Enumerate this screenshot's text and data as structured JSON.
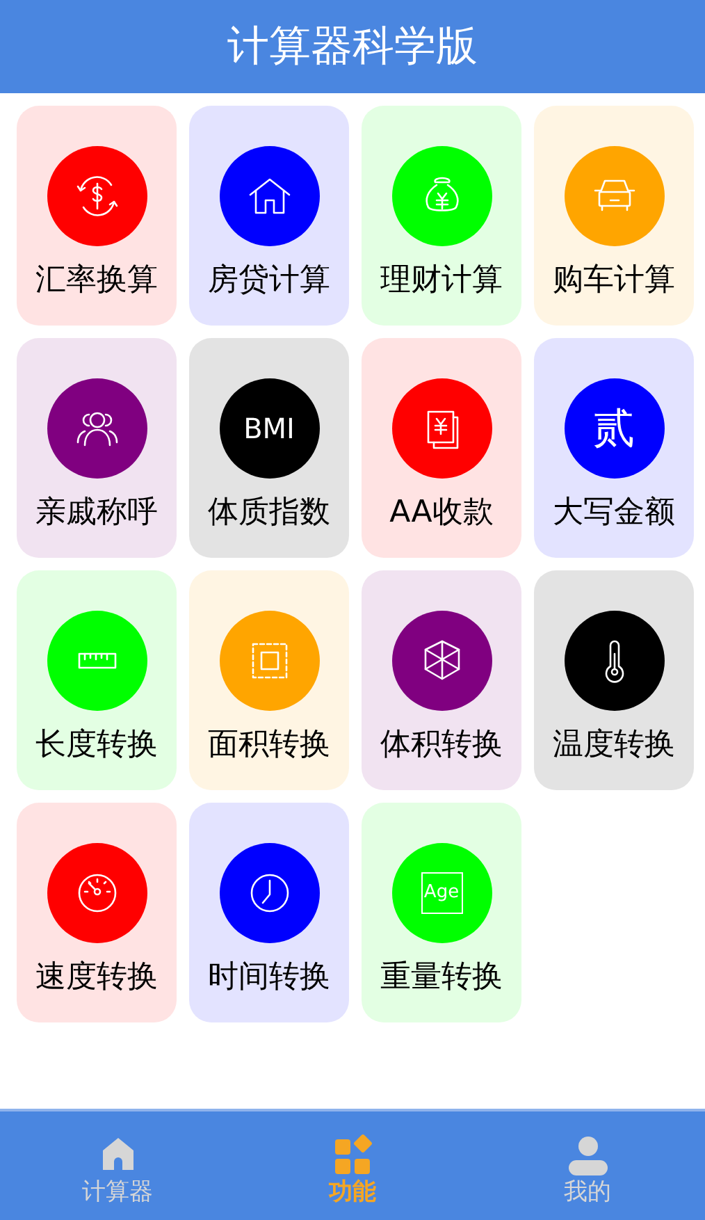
{
  "header": {
    "title": "计算器科学版"
  },
  "tools": [
    {
      "label": "汇率换算",
      "color": "#ff0000"
    },
    {
      "label": "房贷计算",
      "color": "#0000ff"
    },
    {
      "label": "理财计算",
      "color": "#00ff00"
    },
    {
      "label": "购车计算",
      "color": "#ffa500"
    },
    {
      "label": "亲戚称呼",
      "color": "#800080"
    },
    {
      "label": "体质指数",
      "color": "#000000",
      "icon_text": "BMI"
    },
    {
      "label": "AA收款",
      "color": "#ff0000"
    },
    {
      "label": "大写金额",
      "color": "#0000ff",
      "icon_text": "贰"
    },
    {
      "label": "长度转换",
      "color": "#00ff00"
    },
    {
      "label": "面积转换",
      "color": "#ffa500"
    },
    {
      "label": "体积转换",
      "color": "#800080"
    },
    {
      "label": "温度转换",
      "color": "#000000"
    },
    {
      "label": "速度转换",
      "color": "#ff0000"
    },
    {
      "label": "时间转换",
      "color": "#0000ff"
    },
    {
      "label": "重量转换",
      "color": "#00ff00",
      "icon_text": "Age"
    }
  ],
  "tab_bar": [
    {
      "label": "计算器",
      "selected": false
    },
    {
      "label": "功能",
      "selected": true
    },
    {
      "label": "我的",
      "selected": false
    }
  ]
}
